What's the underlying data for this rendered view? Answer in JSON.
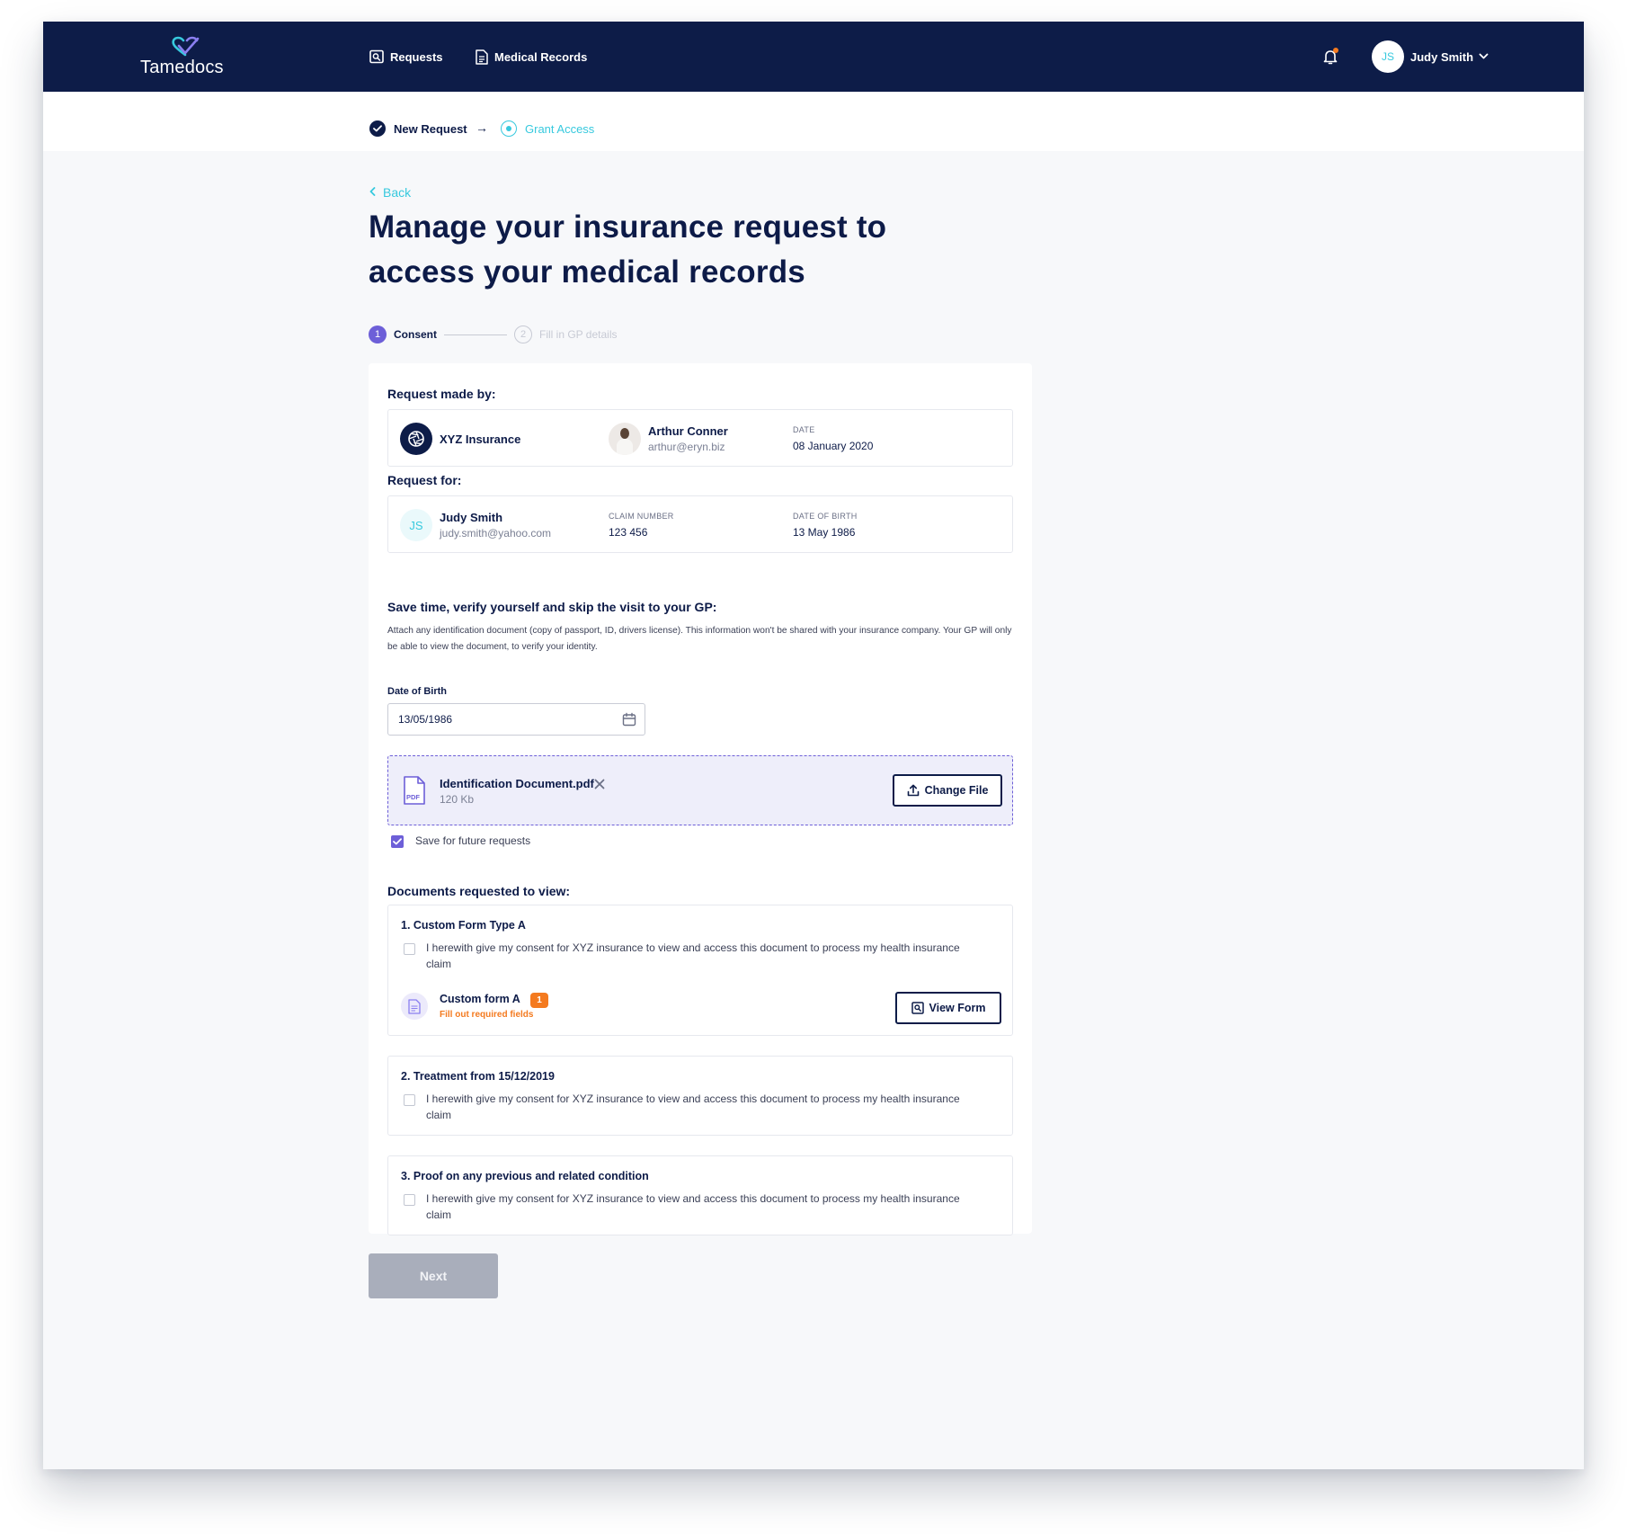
{
  "brand": {
    "name": "Tamedocs"
  },
  "nav": {
    "requests_label": "Requests",
    "medical_records_label": "Medical Records",
    "user_initials": "JS",
    "user_name": "Judy Smith"
  },
  "breadcrumb": {
    "step1_label": "New Request",
    "arrow": "→",
    "step2_label": "Grant Access"
  },
  "page": {
    "back_label": "Back",
    "title": "Manage your insurance request to access your medical records"
  },
  "stepper": {
    "step1": {
      "number": "1",
      "label": "Consent"
    },
    "step2": {
      "number": "2",
      "label": "Fill in GP details"
    }
  },
  "request_made_by": {
    "heading": "Request made by:",
    "company": "XYZ Insurance",
    "agent_name": "Arthur Conner",
    "agent_email": "arthur@eryn.biz",
    "date_label": "DATE",
    "date_value": "08 January 2020"
  },
  "request_for": {
    "heading": "Request for:",
    "initials": "JS",
    "name": "Judy Smith",
    "email": "judy.smith@yahoo.com",
    "claim_label": "CLAIM NUMBER",
    "claim_value": "123 456",
    "dob_label": "DATE OF BIRTH",
    "dob_value": "13 May 1986"
  },
  "verify": {
    "heading": "Save time, verify yourself and skip the visit to your GP:",
    "description": "Attach any identification document (copy of passport, ID, drivers license). This information won't be shared with your insurance company. Your GP will only be able to view the document, to verify your identity.",
    "dob_field_label": "Date of Birth",
    "dob_field_value": "13/05/1986",
    "file_name": "Identification Document.pdf",
    "file_size": "120 Kb",
    "pdf_tag": "PDF",
    "change_file_label": "Change File",
    "save_future_label": "Save for future requests",
    "save_future_checked": true
  },
  "documents": {
    "heading": "Documents requested to view:",
    "items": [
      {
        "title": "1. Custom Form Type A",
        "consent": "I herewith give my consent for XYZ insurance to view and access this document to process my health insurance claim",
        "form_name": "Custom form A",
        "form_badge": "1",
        "form_warning": "Fill out required fields",
        "view_label": "View Form"
      },
      {
        "title": "2. Treatment from 15/12/2019",
        "consent": "I herewith give my consent for XYZ insurance to view and access this document to process my health insurance claim"
      },
      {
        "title": "3. Proof on any previous and related condition",
        "consent": "I herewith give my consent for XYZ insurance to view and access this document to process my health insurance claim"
      }
    ]
  },
  "footer": {
    "next_label": "Next"
  },
  "colors": {
    "navy": "#0d1c48",
    "accent_cyan": "#37c9de",
    "accent_purple": "#6d5fd8",
    "warning_orange": "#f47a1f",
    "disabled_gray": "#a9aebb"
  }
}
